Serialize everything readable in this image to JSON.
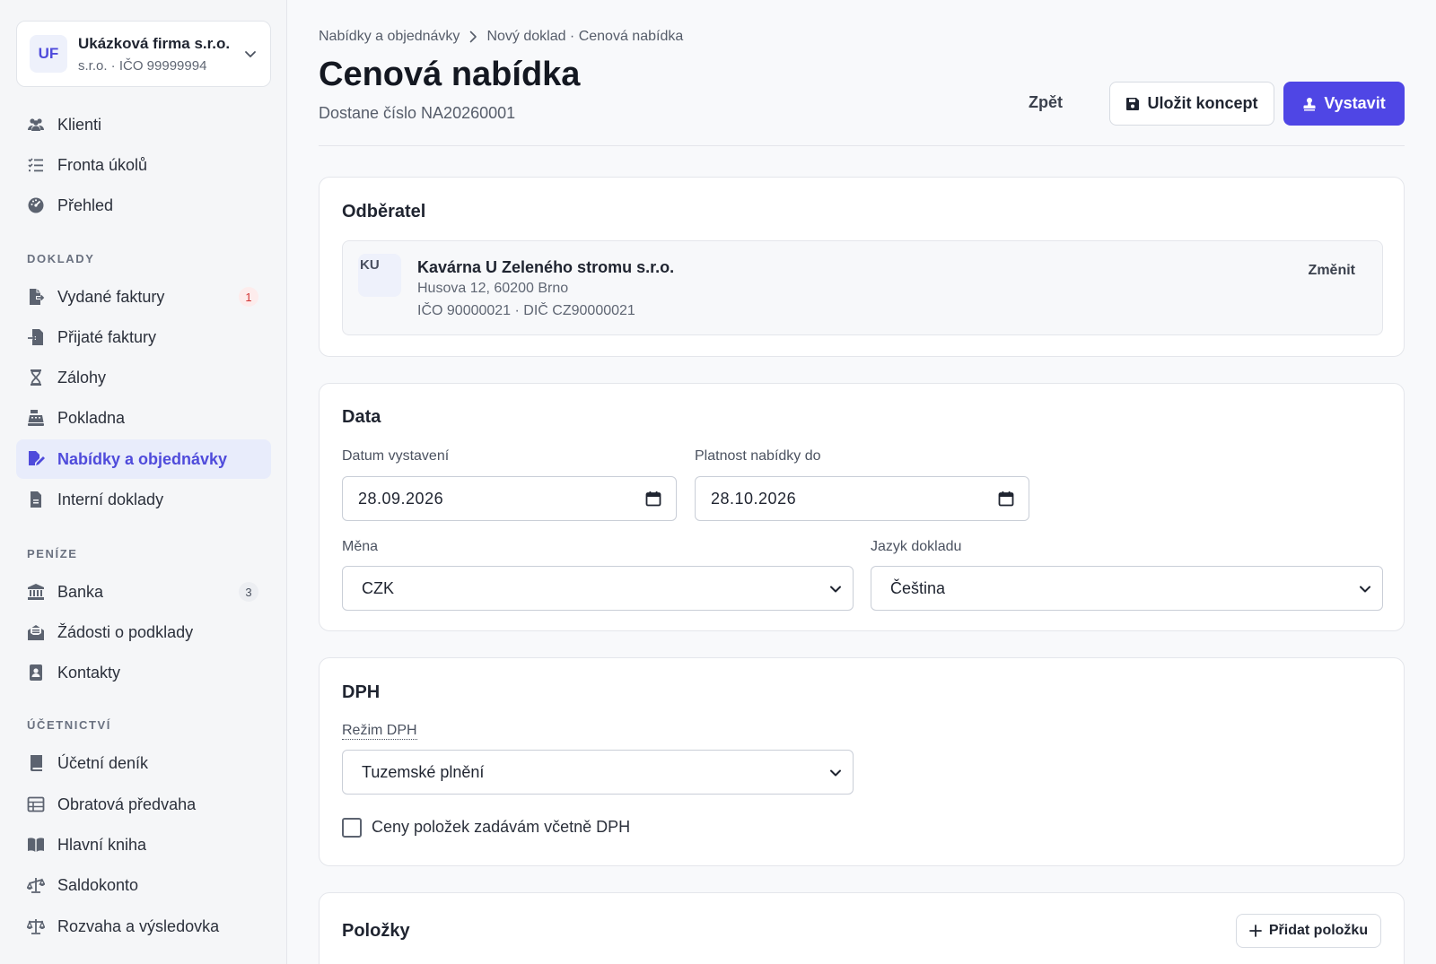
{
  "company": {
    "initials": "UF",
    "name": "Ukázková firma s.r.o.",
    "subtitle": "s.r.o. · IČO 99999994"
  },
  "nav": {
    "top": [
      {
        "label": "Klienti",
        "icon": "users-icon"
      },
      {
        "label": "Fronta úkolů",
        "icon": "task-list-icon"
      },
      {
        "label": "Přehled",
        "icon": "dashboard-gauge-icon"
      }
    ],
    "doklady_label": "DOKLADY",
    "doklady": [
      {
        "label": "Vydané faktury",
        "icon": "invoice-out-icon",
        "badge": "1"
      },
      {
        "label": "Přijaté faktury",
        "icon": "invoice-in-icon"
      },
      {
        "label": "Zálohy",
        "icon": "hourglass-icon"
      },
      {
        "label": "Pokladna",
        "icon": "cash-register-icon"
      },
      {
        "label": "Nabídky a objednávky",
        "icon": "file-signature-icon",
        "active": true
      },
      {
        "label": "Interní doklady",
        "icon": "file-icon"
      }
    ],
    "penize_label": "PENÍZE",
    "penize": [
      {
        "label": "Banka",
        "icon": "bank-icon",
        "badge": "3"
      },
      {
        "label": "Žádosti o podklady",
        "icon": "envelope-open-icon"
      },
      {
        "label": "Kontakty",
        "icon": "address-book-icon"
      }
    ],
    "ucetnictvi_label": "ÚČETNICTVÍ",
    "ucetnictvi": [
      {
        "label": "Účetní deník",
        "icon": "book-icon"
      },
      {
        "label": "Obratová předvaha",
        "icon": "table-icon"
      },
      {
        "label": "Hlavní kniha",
        "icon": "book-open-icon"
      },
      {
        "label": "Saldokonto",
        "icon": "scale-unbalanced-icon"
      },
      {
        "label": "Rozvaha a výsledovka",
        "icon": "scale-balanced-icon"
      }
    ]
  },
  "header": {
    "breadcrumb_parent": "Nabídky a objednávky",
    "breadcrumb_current": "Nový doklad · Cenová nabídka",
    "title": "Cenová nabídka",
    "subtitle": "Dostane číslo NA20260001",
    "back_label": "Zpět",
    "save_draft_label": "Uložit koncept",
    "issue_label": "Vystavit"
  },
  "customer_card": {
    "title": "Odběratel",
    "initials": "KU",
    "name": "Kavárna U Zeleného stromu s.r.o.",
    "address": "Husova 12, 60200 Brno",
    "ids": "IČO 90000021 · DIČ CZ90000021",
    "change_label": "Změnit"
  },
  "data_card": {
    "title": "Data",
    "issue_date_label": "Datum vystavení",
    "issue_date_value": "28.09.2026",
    "valid_until_label": "Platnost nabídky do",
    "valid_until_value": "28.10.2026",
    "currency_label": "Měna",
    "currency_value": "CZK",
    "language_label": "Jazyk dokladu",
    "language_value": "Čeština"
  },
  "vat_card": {
    "title": "DPH",
    "mode_label": "Režim DPH",
    "mode_value": "Tuzemské plnění",
    "prices_incl_vat_label": "Ceny položek zadávám včetně DPH",
    "prices_incl_vat_checked": false
  },
  "items_card": {
    "title": "Položky",
    "add_label": "Přidat položku"
  },
  "colors": {
    "accent": "#4f46e5",
    "active_bg": "#e8ecfb",
    "badge_red": "#d23434"
  }
}
